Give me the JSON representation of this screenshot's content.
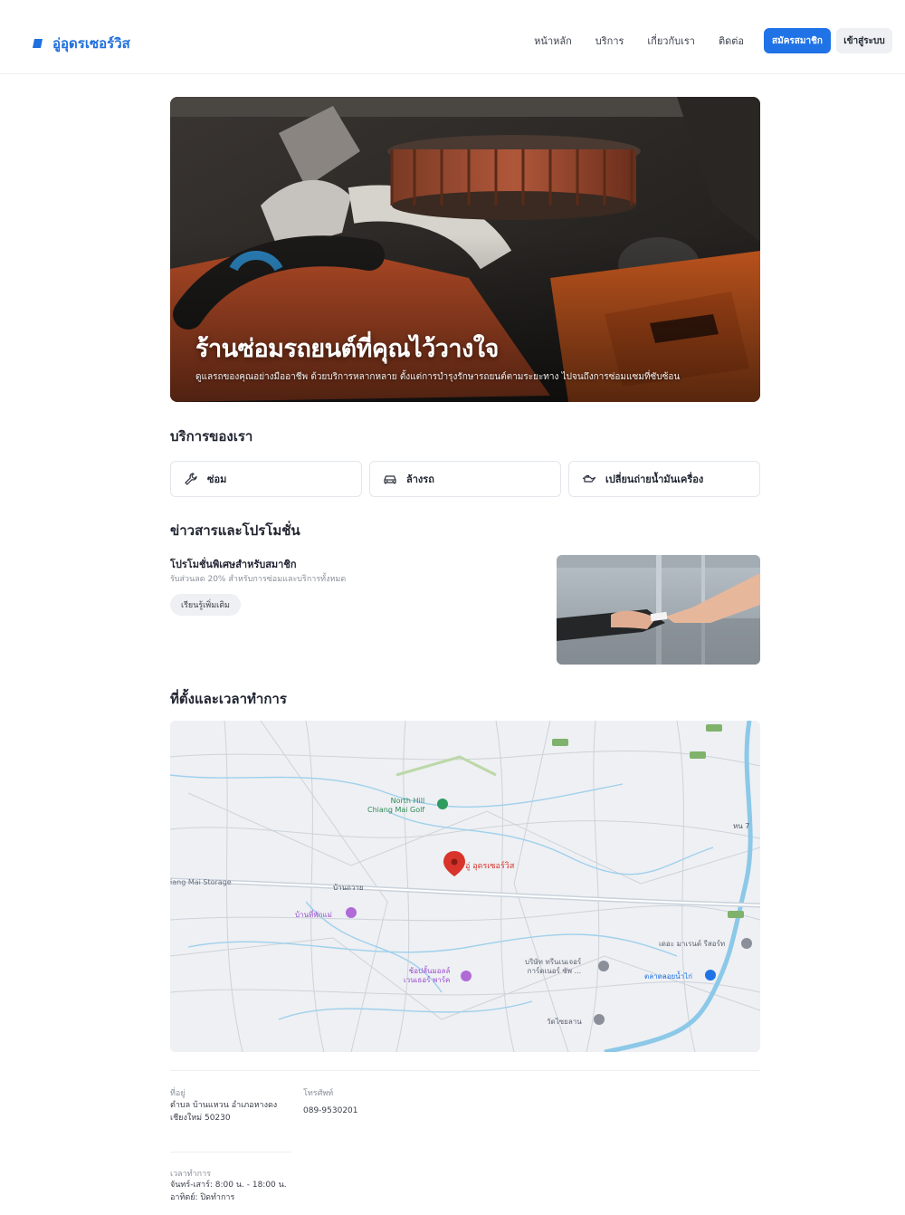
{
  "header": {
    "brand": "อู่อุดรเซอร์วิส",
    "nav": [
      "หน้าหลัก",
      "บริการ",
      "เกี่ยวกับเรา",
      "ติดต่อ"
    ],
    "register_label": "สมัครสมาชิก",
    "login_label": "เข้าสู่ระบบ",
    "accent": "#1f73e6"
  },
  "hero": {
    "title": "ร้านซ่อมรถยนต์ที่คุณไว้วางใจ",
    "subtitle": "ดูแลรถของคุณอย่างมืออาชีพ ด้วยบริการหลากหลาย ตั้งแต่การบำรุงรักษารถยนต์ตามระยะทาง ไปจนถึงการซ่อมแซมที่ซับซ้อน"
  },
  "services": {
    "heading": "บริการของเรา",
    "items": [
      {
        "label": "ซ่อม",
        "icon": "wrench-icon"
      },
      {
        "label": "ล้างรถ",
        "icon": "car-icon"
      },
      {
        "label": "เปลี่ยนถ่ายน้ำมันเครื่อง",
        "icon": "oil-can-icon"
      }
    ]
  },
  "news": {
    "heading": "ข่าวสารและโปรโมชั่น",
    "promo_title": "โปรโมชั่นพิเศษสำหรับสมาชิก",
    "promo_desc": "รับส่วนลด 20% สำหรับการซ่อมและบริการทั้งหมด",
    "promo_button": "เรียนรู้เพิ่มเติม"
  },
  "location": {
    "heading": "ที่ตั้งและเวลาทำการ",
    "map": {
      "pin_label": "อู่ อุดรเซอร์วิส",
      "labels": {
        "golf": "North Hill\nChiang Mai Golf",
        "storage": "iang Mai Storage",
        "banthawai": "บ้านถวาย",
        "banphaemai": "บ้านที่พักแม่",
        "market": "ช้อปลั้นมอลล์\nเวนเธอร์ พาร์ค",
        "company": "บริษัท ทรีนเนเจอร์\nการ์ดเนอร์ ซัพ ...",
        "dam": "ตลาดลอยน้ำไก่",
        "temple": "วัดไซยลาน",
        "resort": "เดอะ มาเรนต์ รีสอร์ท",
        "road_num": "หน 7"
      }
    },
    "address_label": "ที่อยู่",
    "address": "ตำบล บ้านแหวน อำเภอหางดง\nเชียงใหม่ 50230",
    "phone_label": "โทรศัพท์",
    "phone": "089-9530201",
    "hours_label": "เวลาทำการ",
    "hours": "จันทร์-เสาร์: 8:00 น. - 18:00 น.\nอาทิตย์: ปิดทำการ"
  }
}
